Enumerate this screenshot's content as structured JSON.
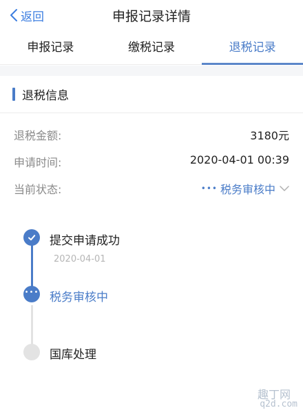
{
  "navbar": {
    "back_label": "返回",
    "title": "申报记录详情"
  },
  "tabs": [
    {
      "label": "申报记录",
      "active": false
    },
    {
      "label": "缴税记录",
      "active": false
    },
    {
      "label": "退税记录",
      "active": true
    }
  ],
  "section": {
    "title": "退税信息"
  },
  "info_rows": [
    {
      "label": "退税金额:",
      "value": "3180元"
    },
    {
      "label": "申请时间:",
      "value": "2020-04-01 00:39"
    },
    {
      "label": "当前状态:",
      "value": "税务审核中",
      "prefix": "•••"
    }
  ],
  "timeline": [
    {
      "label": "提交申请成功",
      "date": "2020-04-01",
      "state": "done",
      "icon": "check-icon"
    },
    {
      "label": "税务审核中",
      "state": "current",
      "icon": "ellipsis-icon",
      "dots": "•••"
    },
    {
      "label": "国库处理",
      "state": "pending",
      "icon": "empty-circle-icon"
    }
  ],
  "watermark": {
    "text": "趣丁网",
    "url": "q2d.com"
  },
  "colors": {
    "accent": "#4a7cc8",
    "label_gray": "#8a8a8a",
    "pending_gray": "#e3e3e3"
  }
}
